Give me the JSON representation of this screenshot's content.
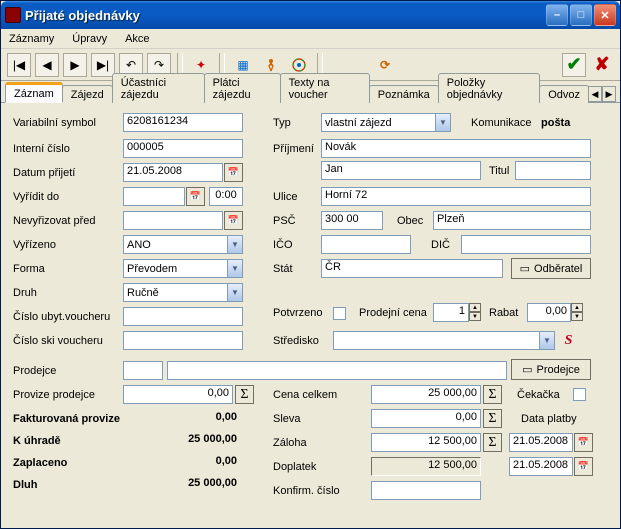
{
  "window": {
    "title": "Přijaté objednávky"
  },
  "menu": {
    "zaznamy": "Záznamy",
    "upravy": "Úpravy",
    "akce": "Akce"
  },
  "toolbar": {
    "first": "⏮",
    "prev": "◀",
    "next": "▶",
    "last": "⏭",
    "undo": "↶",
    "redo": "↷",
    "new": "✦",
    "grid": "▦",
    "run": "🏃",
    "globe": "◉",
    "refresh": "⟳",
    "ok": "✔",
    "cancel": "✘"
  },
  "tabs": {
    "zaznam": "Záznam",
    "zajezd": "Zájezd",
    "ucastnici": "Účastníci zájezdu",
    "platci": "Plátci zájezdu",
    "texty": "Texty na voucher",
    "poznamka": "Poznámka",
    "polozky": "Položky objednávky",
    "odvoz": "Odvoz"
  },
  "left": {
    "var_sym_lbl": "Variabilní symbol",
    "var_sym": "6208161234",
    "int_cislo_lbl": "Interní číslo",
    "int_cislo": "000005",
    "datum_prijeti_lbl": "Datum přijetí",
    "datum_prijeti": "21.05.2008",
    "vyridit_do_lbl": "Vyřídit do",
    "vyridit_do": "",
    "vyridit_time": "0:00",
    "nevyrizovat_lbl": "Nevyřizovat před",
    "nevyrizovat": "",
    "vyrizeno_lbl": "Vyřízeno",
    "vyrizeno": "ANO",
    "forma_lbl": "Forma",
    "forma": "Převodem",
    "druh_lbl": "Druh",
    "druh": "Ručně",
    "ubyt_voucher_lbl": "Číslo ubyt.voucheru",
    "ubyt_voucher": "",
    "ski_voucher_lbl": "Číslo ski voucheru",
    "ski_voucher": "",
    "prodejce_lbl": "Prodejce",
    "prodejce1": "",
    "prodejce2": "",
    "provize_lbl": "Provize prodejce",
    "provize": "0,00",
    "fakt_provize_lbl": "Fakturovaná provize",
    "fakt_provize": "0,00",
    "k_uhrade_lbl": "K úhradě",
    "k_uhrade": "25 000,00",
    "zaplaceno_lbl": "Zaplaceno",
    "zaplaceno": "0,00",
    "dluh_lbl": "Dluh",
    "dluh": "25 000,00"
  },
  "right": {
    "typ_lbl": "Typ",
    "typ": "vlastní zájezd",
    "komunikace_lbl": "Komunikace",
    "komunikace": "pošta",
    "prijmeni_lbl": "Příjmení",
    "prijmeni": "Novák",
    "jmeno": "Jan",
    "titul_lbl": "Titul",
    "titul": "",
    "ulice_lbl": "Ulice",
    "ulice": "Horní 72",
    "psc_lbl": "PSČ",
    "psc": "300 00",
    "obec_lbl": "Obec",
    "obec": "Plzeň",
    "ico_lbl": "IČO",
    "ico": "",
    "dic_lbl": "DIČ",
    "dic": "",
    "stat_lbl": "Stát",
    "stat": "ČR",
    "odberatel_btn": "Odběratel",
    "potvrzeno_lbl": "Potvrzeno",
    "prodcena_lbl": "Prodejní cena",
    "prodcena": "1",
    "rabat_lbl": "Rabat",
    "rabat": "0,00",
    "stredisko_lbl": "Středisko",
    "stredisko": "",
    "prodejce_btn": "Prodejce",
    "cena_celkem_lbl": "Cena celkem",
    "cena_celkem": "25 000,00",
    "sleva_lbl": "Sleva",
    "sleva": "0,00",
    "zaloha_lbl": "Záloha",
    "zaloha": "12 500,00",
    "doplatek_lbl": "Doplatek",
    "doplatek": "12 500,00",
    "konfirm_lbl": "Konfirm. číslo",
    "konfirm": "",
    "cekacka_lbl": "Čekačka",
    "data_platby_lbl": "Data platby",
    "platba1": "21.05.2008",
    "platba2": "21.05.2008"
  }
}
